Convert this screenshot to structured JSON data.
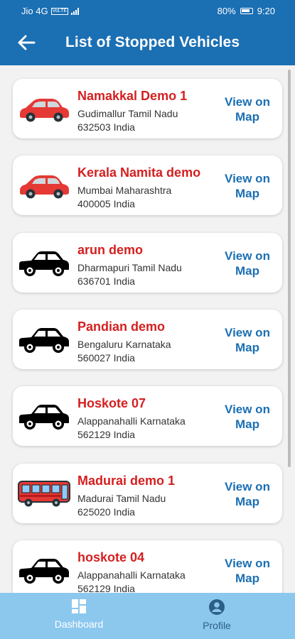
{
  "statusbar": {
    "carrier": "Jio 4G",
    "volte": "VoLTE",
    "battery": "80%",
    "time": "9:20"
  },
  "header": {
    "title": "List of Stopped Vehicles"
  },
  "vehicles": [
    {
      "name": "Namakkal Demo 1",
      "address_line1": "Gudimallur Tamil Nadu",
      "address_line2": "632503 India",
      "map_line1": "View on",
      "map_line2": "Map",
      "icon": "red-car-icon"
    },
    {
      "name": "Kerala Namita demo",
      "address_line1": "Mumbai Maharashtra",
      "address_line2": "400005 India",
      "map_line1": "View on",
      "map_line2": "Map",
      "icon": "red-car-icon"
    },
    {
      "name": "arun demo",
      "address_line1": "Dharmapuri Tamil Nadu",
      "address_line2": "636701 India",
      "map_line1": "View on",
      "map_line2": "Map",
      "icon": "black-car-icon"
    },
    {
      "name": "Pandian demo",
      "address_line1": "Bengaluru Karnataka",
      "address_line2": "560027 India",
      "map_line1": "View on",
      "map_line2": "Map",
      "icon": "black-car-icon"
    },
    {
      "name": "Hoskote 07",
      "address_line1": "Alappanahalli Karnataka",
      "address_line2": "562129 India",
      "map_line1": "View on",
      "map_line2": "Map",
      "icon": "black-car-icon"
    },
    {
      "name": "Madurai demo 1",
      "address_line1": "Madurai Tamil Nadu",
      "address_line2": "625020 India",
      "map_line1": "View on",
      "map_line2": "Map",
      "icon": "bus-icon"
    },
    {
      "name": "hoskote 04",
      "address_line1": "Alappanahalli Karnataka",
      "address_line2": "562129 India",
      "map_line1": "View on",
      "map_line2": "Map",
      "icon": "black-car-icon"
    }
  ],
  "bottom_nav": {
    "dashboard": "Dashboard",
    "profile": "Profile"
  },
  "colors": {
    "primary": "#1b6fb3",
    "vehicle_name": "#d42020",
    "bottom_nav": "#8cc7ee"
  }
}
